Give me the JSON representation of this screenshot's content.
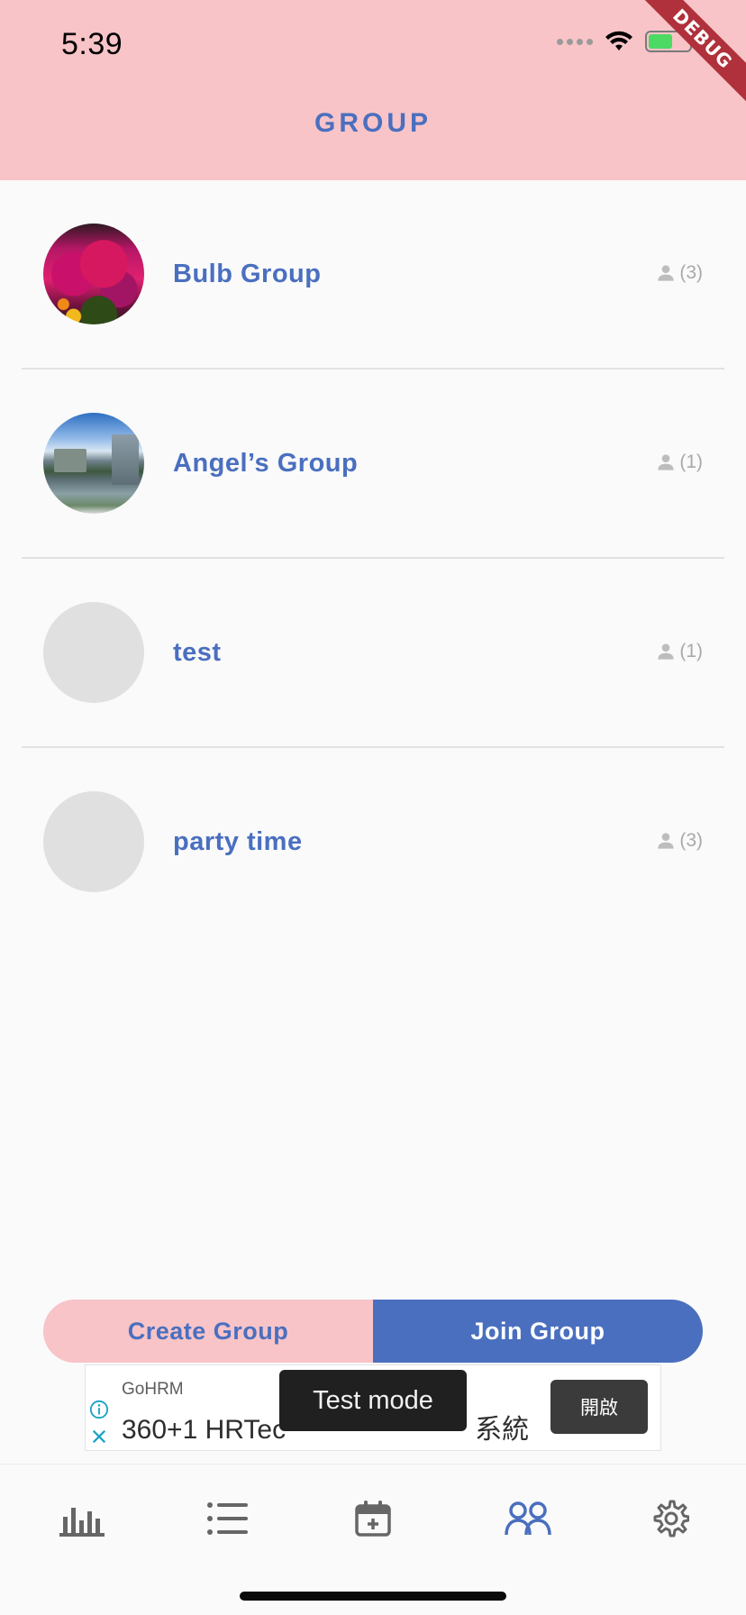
{
  "status_bar": {
    "time": "5:39"
  },
  "debug_banner": "DEBUG",
  "header": {
    "title": "GROUP"
  },
  "groups": [
    {
      "name": "Bulb Group",
      "members": "(3)",
      "avatar": "flowers-photo"
    },
    {
      "name": "Angel’s Group",
      "members": "(1)",
      "avatar": "lake-photo"
    },
    {
      "name": "test",
      "members": "(1)",
      "avatar": "placeholder"
    },
    {
      "name": "party time",
      "members": "(3)",
      "avatar": "placeholder"
    }
  ],
  "actions": {
    "create_label": "Create Group",
    "join_label": "Join Group"
  },
  "ad": {
    "advertiser": "GoHRM",
    "headline": "360+1 HRTec",
    "headline_tail": "系統",
    "cta": "開啟",
    "test_mode": "Test mode"
  },
  "tab_bar": {
    "tabs": [
      {
        "icon": "bar-chart-icon",
        "active": false
      },
      {
        "icon": "list-icon",
        "active": false
      },
      {
        "icon": "calendar-add-icon",
        "active": false
      },
      {
        "icon": "group-icon",
        "active": true
      },
      {
        "icon": "settings-icon",
        "active": false
      }
    ]
  },
  "colors": {
    "header_bg": "#f8c4c8",
    "accent": "#4a6fbf",
    "inactive_icon": "#666666"
  }
}
